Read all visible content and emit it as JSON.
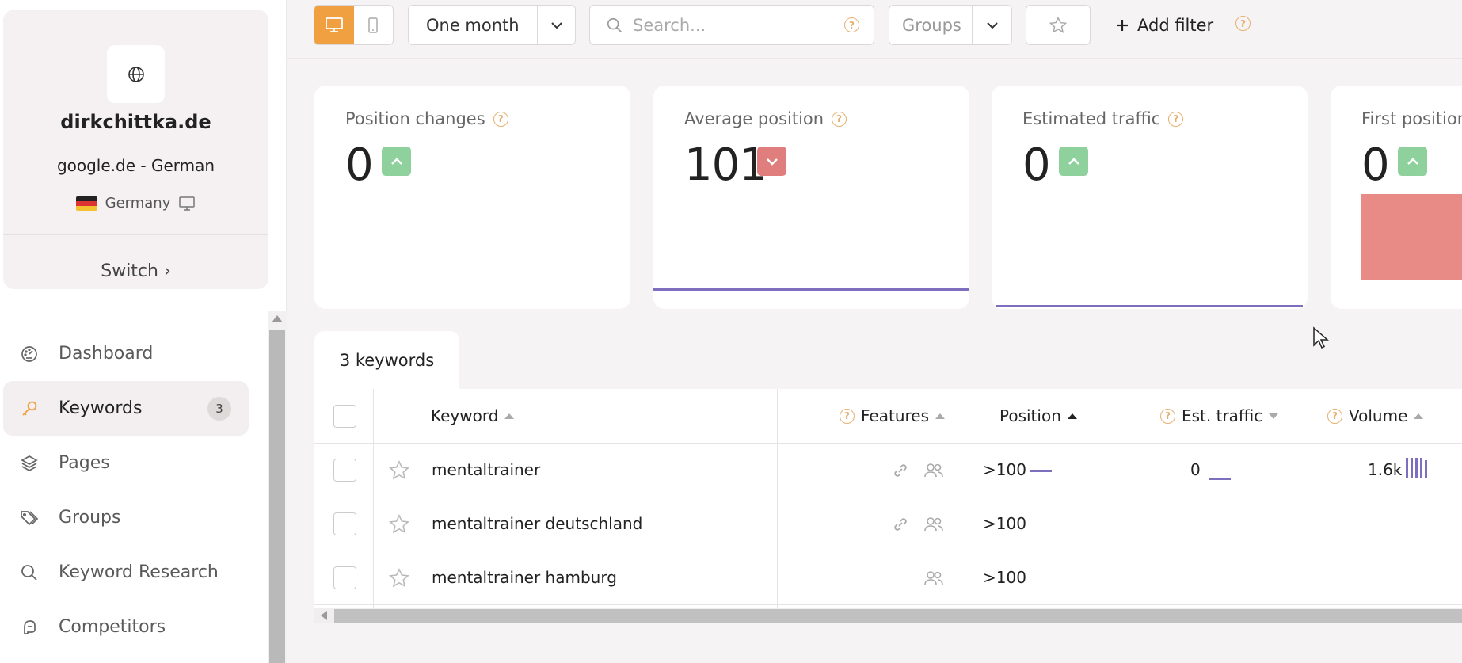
{
  "site": {
    "domain": "dirkchittka.de",
    "engine": "google.de - German",
    "country": "Germany",
    "switch_label": "Switch ›"
  },
  "sidebar": {
    "items": [
      {
        "label": "Dashboard",
        "icon": "dashboard-gauge-icon"
      },
      {
        "label": "Keywords",
        "icon": "key-icon",
        "badge": "3",
        "active": true
      },
      {
        "label": "Pages",
        "icon": "layers-icon"
      },
      {
        "label": "Groups",
        "icon": "tags-icon"
      },
      {
        "label": "Keyword Research",
        "icon": "search-icon"
      },
      {
        "label": "Competitors",
        "icon": "boxing-glove-icon"
      }
    ]
  },
  "toolbar": {
    "period_label": "One month",
    "search_placeholder": "Search...",
    "groups_label": "Groups",
    "add_filter_label": "Add filter"
  },
  "cards": [
    {
      "title": "Position changes",
      "value": "0",
      "trend": "up"
    },
    {
      "title": "Average position",
      "value": "101",
      "trend": "down"
    },
    {
      "title": "Estimated traffic",
      "value": "0",
      "trend": "up"
    },
    {
      "title": "First position",
      "value": "0",
      "trend": "up"
    }
  ],
  "table": {
    "tab_label": "3 keywords",
    "columns": {
      "keyword": "Keyword",
      "features": "Features",
      "position": "Position",
      "traffic": "Est. traffic",
      "volume": "Volume"
    },
    "rows": [
      {
        "keyword": "mentaltrainer",
        "position": ">100",
        "traffic": "0",
        "volume": "1.6k"
      },
      {
        "keyword": "mentaltrainer deutschland",
        "position": ">100",
        "traffic": "",
        "volume": ""
      },
      {
        "keyword": "mentaltrainer hamburg",
        "position": ">100",
        "traffic": "",
        "volume": ""
      }
    ]
  },
  "colors": {
    "accent": "#f0a040",
    "trend_up": "#8fd19c",
    "trend_down": "#e07d7d",
    "spark": "#7d6fbe",
    "help": "#e6b071"
  }
}
